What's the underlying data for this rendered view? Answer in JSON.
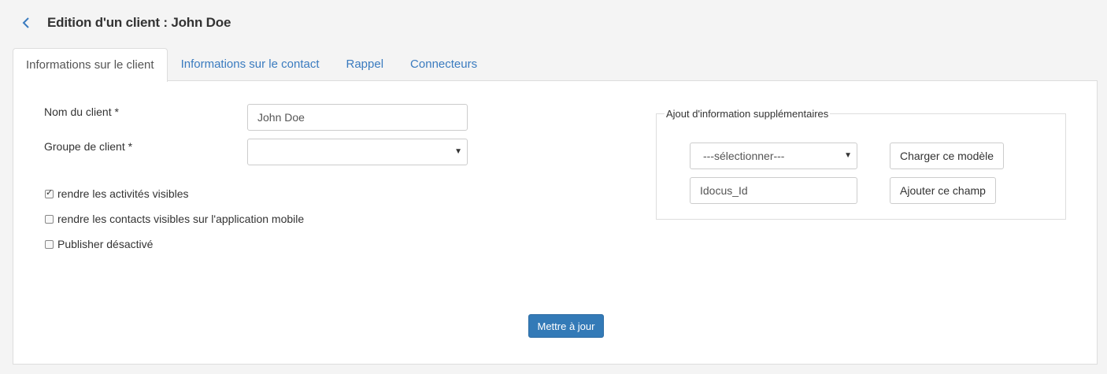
{
  "header": {
    "title": "Edition d'un client : John Doe"
  },
  "tabs": [
    {
      "label": "Informations sur le client",
      "active": true
    },
    {
      "label": "Informations sur le contact",
      "active": false
    },
    {
      "label": "Rappel",
      "active": false
    },
    {
      "label": "Connecteurs",
      "active": false
    }
  ],
  "form": {
    "client_name_label": "Nom du client *",
    "client_name_value": "John Doe",
    "client_group_label": "Groupe de client *",
    "client_group_value": "",
    "checkboxes": [
      {
        "label": "rendre les activités visibles",
        "checked": true
      },
      {
        "label": "rendre les contacts visibles sur l'application mobile",
        "checked": false
      },
      {
        "label": "Publisher désactivé",
        "checked": false
      }
    ]
  },
  "extra_info": {
    "legend": "Ajout d'information supplémentaires",
    "template_select_value": "---sélectionner---",
    "load_template_button": "Charger ce modèle",
    "field_name_value": "Idocus_Id",
    "add_field_button": "Ajouter ce champ"
  },
  "actions": {
    "update_button": "Mettre à jour"
  },
  "colors": {
    "accent": "#337ab7",
    "link": "#3a7bbf",
    "background": "#f4f4f4"
  }
}
